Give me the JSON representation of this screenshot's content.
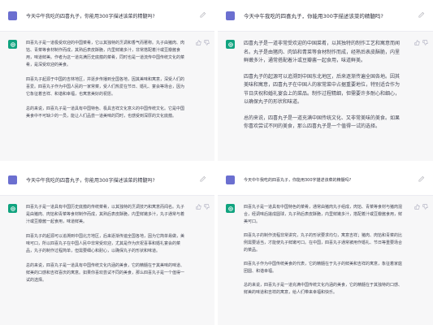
{
  "panels": [
    {
      "question": "今天中午我吃的四喜丸子，你能用300字描述该菜的精髓吗?",
      "answer": [
        "四喜丸子是一道极受欢迎的中国菜肴，它以其独特的烹调和香气而著称。丸子由猪肉、肉馅、青菜等食材制作而成，其熟后表皮酥脆，内里鲜嫩多汁，非常搭配着汁或豆瓣酱食用，味道鲜美。作者为这一道充满历史底蕴的菜肴，同时也是一道流传中国传统文化的菜肴，是深受欢迎的美食。",
        "四喜丸子起源于中国的吉林地区，并逐步传播到全国各地，因其美味和寓意，深受人们的喜爱。四喜丸子作为中国人民的一家常菜，受人们热爱在节日、婚礼、宴会等场合，因为它象征着吉祥、和谐和幸福，也寓意美好的祝愿。",
        "总的来说，四喜丸子是一道具有中国特色、极具吉祥文化意义的中国传统文化。它是中国美食中不可缺少的一员，能让人们品尝一道美味的同时，也感受到深厚的文化底蕴。"
      ]
    },
    {
      "question": "今天中午我吃的四喜丸子，你能用300字描述该菜的精髓吗?",
      "answer": [
        "四喜丸子是一道非常受欢迎的中国菜肴，以其独特的制作工艺和寓意而闻名。丸子是由猪肉、肉馅和青菜等食材制作而成，经熟后表皮酥脆，内里鲜嫩多汁，通常搭配着汁或豆瓣酱一起食用，味道鲜美。",
        "四喜丸子的起源可以追溯到中国东北地区，后来逐渐传遍全国各地。因其美味和寓意，四喜丸子在中国人的家常菜中占据重要地位，特别适合作为节日庆祝和婚礼宴会上的菜品。制作过程精细，但需要许多耐心和细心，以确保丸子的形状和味道。",
        "总的来说，四喜丸子是一道充满中国传统文化、又非常美味的美食。如果你喜欢尝试不同的美食，那么四喜丸子是一个值得一试的选择。"
      ]
    },
    {
      "question": "今天中午我吃的四喜丸子，你能用300字描述该菜的精髓吗?",
      "answer": [
        "四喜丸子是一道具有中国历史底蕴的传统菜肴，以其独特的烹调技巧和寓意而闻名。丸子是由猪肉、肉馅和青菜等食材制作而成，其熟后表皮酥脆，内里鲜嫩多汁，丸子通常与着汁或豆瓣酱一起食用，味道鲜美。",
        "四喜丸子的起源可以追溯到中国北方地区，后来逐渐传遍全国各地，因为它简单易做，美味可口，所以四喜丸子在中国人民中非常受欢迎，尤其是作为庆祝喜事和婚礼宴会的菜品，丸子的制作过程简单，但需要细心和耐心，以确保丸子的形状和味道。",
        "总的来说，四喜丸子是一道具有中国传统文化内涵的美食，它的精髓在于其美味的味道、鲜美的口感和吉祥喜庆的寓意。如果你喜欢尝试不同的美食，那么四喜丸子是一个值得一试的选择。"
      ]
    },
    {
      "question": "今天中午我吃的四喜丸子，你能用300字描述该菜的精髓吗?",
      "answer": [
        "四喜丸子是一道具有中国特色的菜肴，通常由猪肉丸子组成，肉馅、青菜等食材与猪肉混合，经调味后搓成圆球，丸子熟后表皮酥脆，内里鲜嫩多汁，搭配着汁或豆瓣酱食用，鲜美可口。",
        "四喜丸子的制作流程非常讲究，丸子的形状要求均匀，寓意吉祥；猪肉、肉馅和青菜的比例需要适当，才能使丸子鲜嫩可口。在中国，四喜丸子通常被用作婚礼、节日等重要场合的菜品。",
        "四喜丸子作为中国传统美食的代表，它的精髓在于丸子的鲜美和吉祥的寓意，象征着家庭团圆、和谐幸福。",
        "总的来说，四喜丸子是一道充满中国传统文化内涵的美食，它的精髓在于其独特的口感、鲜美的味道和吉祥的寓意，给人们带来幸福和快乐。"
      ]
    }
  ]
}
